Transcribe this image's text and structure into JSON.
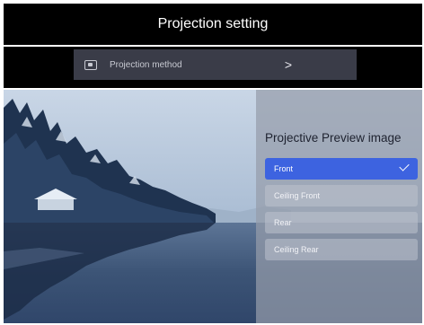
{
  "header": {
    "title": "Projection setting"
  },
  "menu": {
    "row_label": "Projection method",
    "row_icon": "projector-icon",
    "chevron_icon": "chevron-right-icon",
    "chevron_glyph": ">"
  },
  "preview": {
    "title": "Projective Preview image",
    "options": [
      {
        "label": "Front",
        "selected": true
      },
      {
        "label": "Ceiling Front",
        "selected": false
      },
      {
        "label": "Rear",
        "selected": false
      },
      {
        "label": "Ceiling Rear",
        "selected": false
      }
    ],
    "check_icon": "checkmark-icon"
  },
  "colors": {
    "header_bg": "#000000",
    "menu_row_bg": "#3a3c48",
    "selected_option": "#3d63e0",
    "panel_overlay": "#969caa"
  }
}
